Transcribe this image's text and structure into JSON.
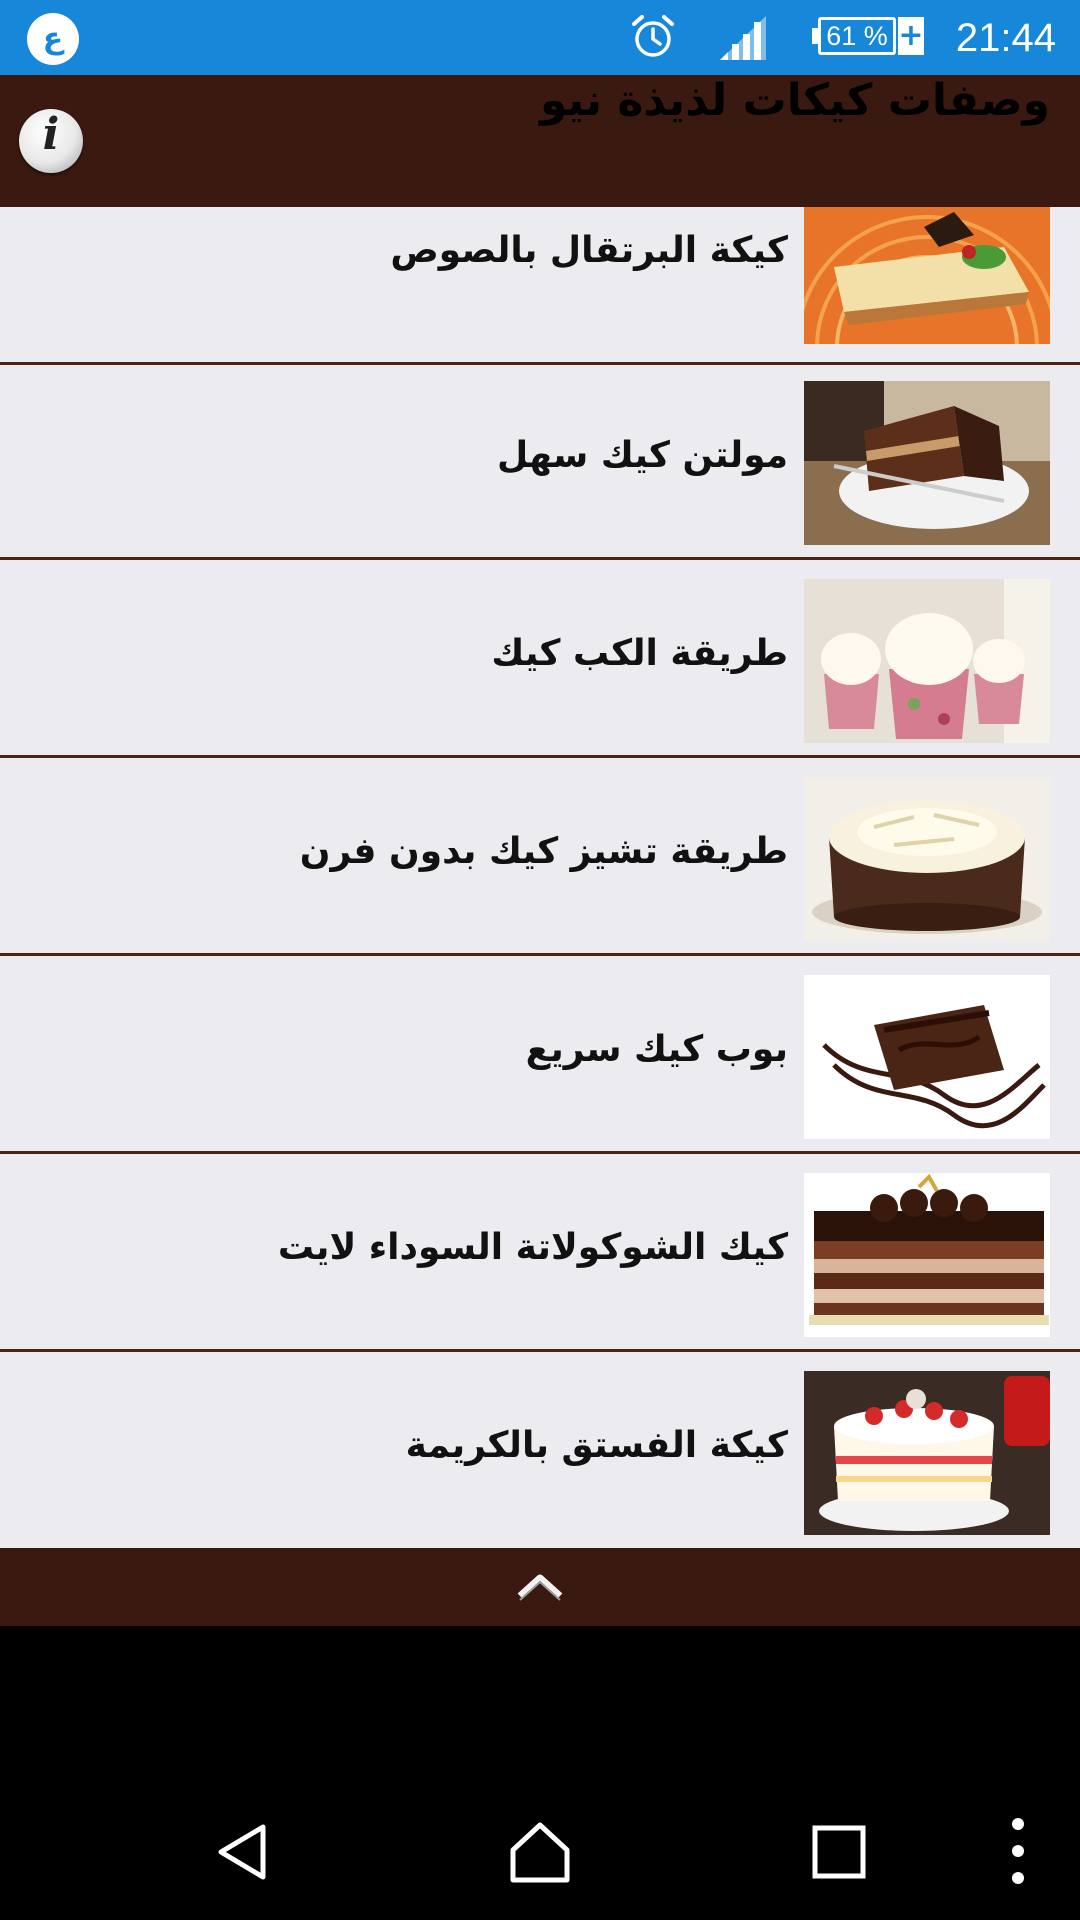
{
  "status_bar": {
    "app_icon_glyph": "ع",
    "battery": "61 %",
    "time": "21:44",
    "icons": [
      "alarm-icon",
      "signal-icon",
      "battery-charging-icon"
    ]
  },
  "app_bar": {
    "title": "وصفات كيكات لذيذة نيو",
    "info_glyph": "i"
  },
  "recipes": [
    {
      "title": "كيكة البرتقال بالصوص"
    },
    {
      "title": "مولتن كيك سهل"
    },
    {
      "title": "طريقة الكب كيك"
    },
    {
      "title": "طريقة تشيز كيك بدون فرن"
    },
    {
      "title": "بوب كيك سريع"
    },
    {
      "title": "كيك الشوكولاتة السوداء لايت"
    },
    {
      "title": "كيكة الفستق بالكريمة"
    }
  ],
  "bottom_bar": {
    "icon": "chevron-up-icon"
  },
  "nav_bar": {
    "icons": [
      "back-icon",
      "home-icon",
      "recents-icon",
      "overflow-menu-icon"
    ]
  },
  "colors": {
    "status": "#1687d9",
    "brown": "#3a1a10",
    "list_bg": "#ebebf0"
  }
}
